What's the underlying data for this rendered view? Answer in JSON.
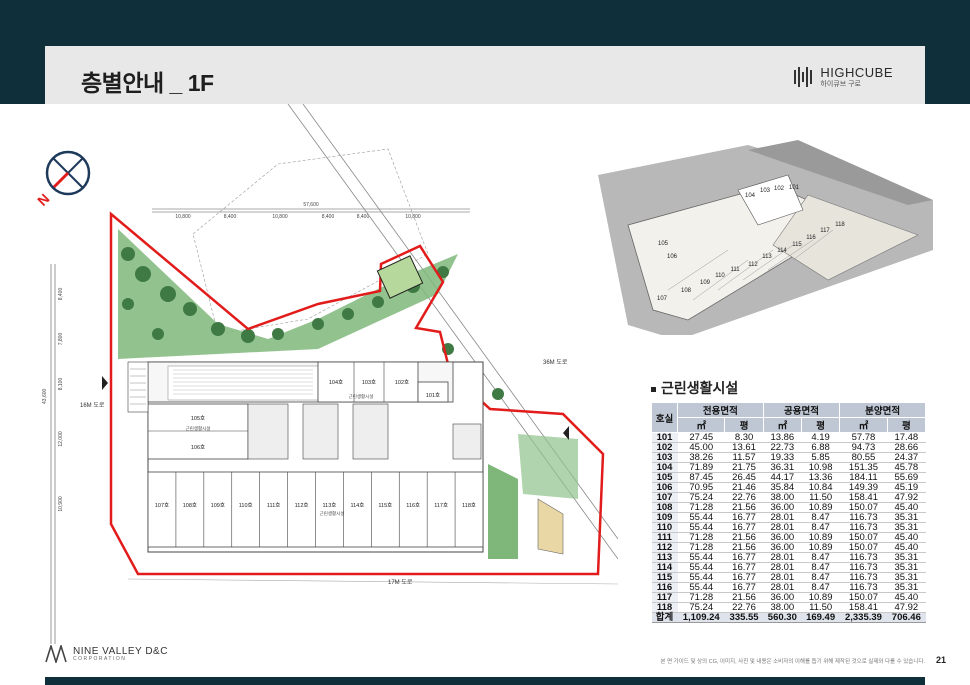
{
  "header": {
    "title": "층별안내 _ 1F",
    "logo_en": "HIGHCUBE",
    "logo_ko": "하이큐브 구로",
    "colors": {
      "band": "#0f2f3a",
      "title_bar": "#e8e8e8",
      "outline": "#e21b1b"
    }
  },
  "plan": {
    "north_label": "N",
    "roads": {
      "road_36m": "36M 도로",
      "road_16m": "16M 도로",
      "road_17m": "17M 도로"
    },
    "top_dims_total": "57,600",
    "top_dims": [
      "10,800",
      "8,400",
      "10,800",
      "8,400",
      "8,400",
      "10,800"
    ],
    "left_dims_total": "43,600",
    "left_dims": [
      "8,400",
      "7,800",
      "8,100",
      "12,000",
      "10,900"
    ],
    "units_top": [
      "104호",
      "103호",
      "102호",
      "101호"
    ],
    "units_mid": [
      "105호",
      "106호"
    ],
    "units_bottom": [
      "107호",
      "108호",
      "109호",
      "110호",
      "111호",
      "112호",
      "113호",
      "114호",
      "115호",
      "116호",
      "117호",
      "118호"
    ],
    "facility_label": "근린생활시설"
  },
  "render": {
    "labels": [
      "101",
      "102",
      "103",
      "104",
      "105",
      "106",
      "107",
      "108",
      "109",
      "110",
      "111",
      "112",
      "113",
      "114",
      "115",
      "116",
      "117",
      "118"
    ]
  },
  "table": {
    "title": "근린생활시설",
    "h_unit": "호실",
    "h_groups": [
      "전용면적",
      "공용면적",
      "분양면적"
    ],
    "h_sub": [
      "㎡",
      "평",
      "㎡",
      "평",
      "㎡",
      "평"
    ],
    "rows": [
      [
        "101",
        "27.45",
        "8.30",
        "13.86",
        "4.19",
        "57.78",
        "17.48"
      ],
      [
        "102",
        "45.00",
        "13.61",
        "22.73",
        "6.88",
        "94.73",
        "28.66"
      ],
      [
        "103",
        "38.26",
        "11.57",
        "19.33",
        "5.85",
        "80.55",
        "24.37"
      ],
      [
        "104",
        "71.89",
        "21.75",
        "36.31",
        "10.98",
        "151.35",
        "45.78"
      ],
      [
        "105",
        "87.45",
        "26.45",
        "44.17",
        "13.36",
        "184.11",
        "55.69"
      ],
      [
        "106",
        "70.95",
        "21.46",
        "35.84",
        "10.84",
        "149.39",
        "45.19"
      ],
      [
        "107",
        "75.24",
        "22.76",
        "38.00",
        "11.50",
        "158.41",
        "47.92"
      ],
      [
        "108",
        "71.28",
        "21.56",
        "36.00",
        "10.89",
        "150.07",
        "45.40"
      ],
      [
        "109",
        "55.44",
        "16.77",
        "28.01",
        "8.47",
        "116.73",
        "35.31"
      ],
      [
        "110",
        "55.44",
        "16.77",
        "28.01",
        "8.47",
        "116.73",
        "35.31"
      ],
      [
        "111",
        "71.28",
        "21.56",
        "36.00",
        "10.89",
        "150.07",
        "45.40"
      ],
      [
        "112",
        "71.28",
        "21.56",
        "36.00",
        "10.89",
        "150.07",
        "45.40"
      ],
      [
        "113",
        "55.44",
        "16.77",
        "28.01",
        "8.47",
        "116.73",
        "35.31"
      ],
      [
        "114",
        "55.44",
        "16.77",
        "28.01",
        "8.47",
        "116.73",
        "35.31"
      ],
      [
        "115",
        "55.44",
        "16.77",
        "28.01",
        "8.47",
        "116.73",
        "35.31"
      ],
      [
        "116",
        "55.44",
        "16.77",
        "28.01",
        "8.47",
        "116.73",
        "35.31"
      ],
      [
        "117",
        "71.28",
        "21.56",
        "36.00",
        "10.89",
        "150.07",
        "45.40"
      ],
      [
        "118",
        "75.24",
        "22.76",
        "38.00",
        "11.50",
        "158.41",
        "47.92"
      ]
    ],
    "total": [
      "합계",
      "1,109.24",
      "335.55",
      "560.30",
      "169.49",
      "2,335.39",
      "706.46"
    ]
  },
  "footer": {
    "company": "NINE VALLEY D&C",
    "company_sub": "CORPORATION",
    "note": "본 면 가이드 및 상의 CG, 이미지, 사진 및 내용은 소비자의 이해를 돕기 위해 제작된 것으로 실제와 다를 수 있습니다.",
    "page": "21"
  }
}
